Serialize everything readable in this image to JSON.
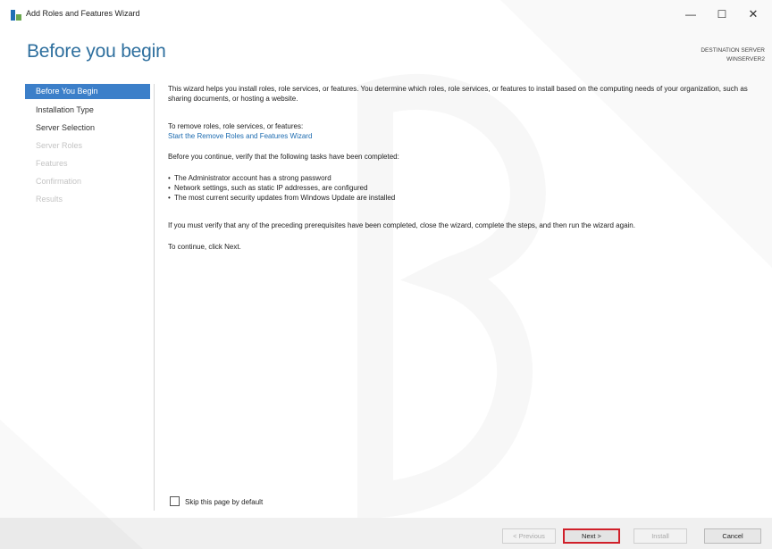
{
  "window": {
    "title": "Add Roles and Features Wizard",
    "minimize_glyph": "—",
    "maximize_glyph": "☐",
    "close_glyph": "✕"
  },
  "header": {
    "heading": "Before you begin",
    "destination_label": "DESTINATION SERVER",
    "destination_value": "WINSERVER2"
  },
  "nav": {
    "items": [
      {
        "label": "Before You Begin",
        "state": "active"
      },
      {
        "label": "Installation Type",
        "state": "enabled"
      },
      {
        "label": "Server Selection",
        "state": "enabled"
      },
      {
        "label": "Server Roles",
        "state": "disabled"
      },
      {
        "label": "Features",
        "state": "disabled"
      },
      {
        "label": "Confirmation",
        "state": "disabled"
      },
      {
        "label": "Results",
        "state": "disabled"
      }
    ]
  },
  "content": {
    "intro": "This wizard helps you install roles, role services, or features. You determine which roles, role services, or features to install based on the computing needs of your organization, such as sharing documents, or hosting a website.",
    "remove_label": "To remove roles, role services, or features:",
    "remove_link": "Start the Remove Roles and Features Wizard",
    "verify_text": "Before you continue, verify that the following tasks have been completed:",
    "bullets": [
      "The Administrator account has a strong password",
      "Network settings, such as static IP addresses, are configured",
      "The most current security updates from Windows Update are installed"
    ],
    "prereq_text": "If you must verify that any of the preceding prerequisites have been completed, close the wizard, complete the steps, and then run the wizard again.",
    "continue_text": "To continue, click Next."
  },
  "skip_checkbox": {
    "label": "Skip this page by default",
    "checked": false
  },
  "footer": {
    "previous_label": "< Previous",
    "next_label": "Next >",
    "install_label": "Install",
    "cancel_label": "Cancel"
  },
  "colors": {
    "accent": "#3c7fc9",
    "heading": "#2e6f9e",
    "link": "#1c6bb0",
    "next_highlight": "#d0202a"
  }
}
